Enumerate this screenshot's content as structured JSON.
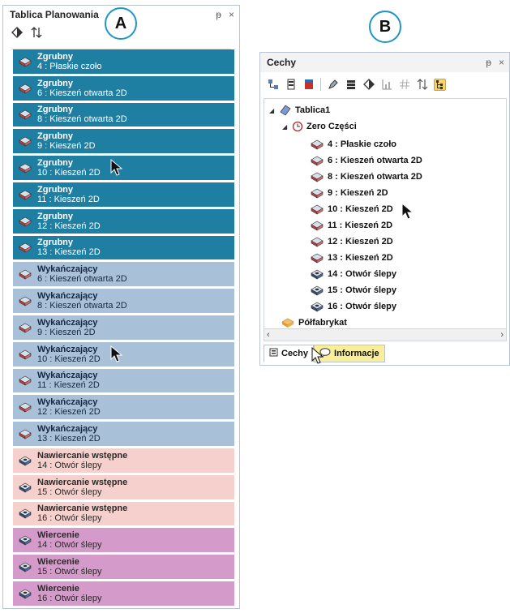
{
  "badges": {
    "a": "A",
    "b": "B"
  },
  "panelA": {
    "title": "Tablica Planowania",
    "pin_glyph": "ᵽ",
    "close_glyph": "×",
    "operations": [
      {
        "family": "Zgrubny",
        "title": "Zgrubny",
        "sub": "4 :  Płaskie czoło"
      },
      {
        "family": "Zgrubny",
        "title": "Zgrubny",
        "sub": "6 :  Kieszeń otwarta 2D"
      },
      {
        "family": "Zgrubny",
        "title": "Zgrubny",
        "sub": "8 :  Kieszeń otwarta 2D"
      },
      {
        "family": "Zgrubny",
        "title": "Zgrubny",
        "sub": "9 :  Kieszeń 2D"
      },
      {
        "family": "Zgrubny",
        "title": "Zgrubny",
        "sub": "10 :  Kieszeń 2D"
      },
      {
        "family": "Zgrubny",
        "title": "Zgrubny",
        "sub": "11 :  Kieszeń 2D"
      },
      {
        "family": "Zgrubny",
        "title": "Zgrubny",
        "sub": "12 :  Kieszeń 2D"
      },
      {
        "family": "Zgrubny",
        "title": "Zgrubny",
        "sub": "13 :  Kieszeń 2D"
      },
      {
        "family": "Wyk",
        "title": "Wykańczający",
        "sub": "6 :  Kieszeń otwarta 2D"
      },
      {
        "family": "Wyk",
        "title": "Wykańczający",
        "sub": "8 :  Kieszeń otwarta 2D"
      },
      {
        "family": "Wyk",
        "title": "Wykańczający",
        "sub": "9 :  Kieszeń 2D"
      },
      {
        "family": "Wyk",
        "title": "Wykańczający",
        "sub": "10 :  Kieszeń 2D"
      },
      {
        "family": "Wyk",
        "title": "Wykańczający",
        "sub": "11 :  Kieszeń 2D"
      },
      {
        "family": "Wyk",
        "title": "Wykańczający",
        "sub": "12 :  Kieszeń 2D"
      },
      {
        "family": "Wyk",
        "title": "Wykańczający",
        "sub": "13 :  Kieszeń 2D"
      },
      {
        "family": "Naw",
        "title": "Nawiercanie wstępne",
        "sub": "14 :  Otwór ślepy"
      },
      {
        "family": "Naw",
        "title": "Nawiercanie wstępne",
        "sub": "15 :  Otwór ślepy"
      },
      {
        "family": "Naw",
        "title": "Nawiercanie wstępne",
        "sub": "16 :  Otwór ślepy"
      },
      {
        "family": "Wier",
        "title": "Wiercenie",
        "sub": "14 :  Otwór ślepy"
      },
      {
        "family": "Wier",
        "title": "Wiercenie",
        "sub": "15 :  Otwór ślepy"
      },
      {
        "family": "Wier",
        "title": "Wiercenie",
        "sub": "16 :  Otwór ślepy"
      }
    ]
  },
  "panelB": {
    "title": "Cechy",
    "pin_glyph": "ᵽ",
    "close_glyph": "×",
    "tree": {
      "root": "Tablica1",
      "zero": "Zero Części",
      "features": [
        "4 :  Płaskie czoło",
        "6 :  Kieszeń otwarta 2D",
        "8 :  Kieszeń otwarta 2D",
        "9 :  Kieszeń 2D",
        "10 :  Kieszeń 2D",
        "11 :  Kieszeń 2D",
        "12 :  Kieszeń 2D",
        "13 :  Kieszeń 2D",
        "14 :  Otwór ślepy",
        "15 :  Otwór ślepy",
        "16 :  Otwór ślepy"
      ],
      "stock": "Półfabrykat"
    },
    "tabs": {
      "features": "Cechy",
      "info": "Informacje"
    }
  }
}
